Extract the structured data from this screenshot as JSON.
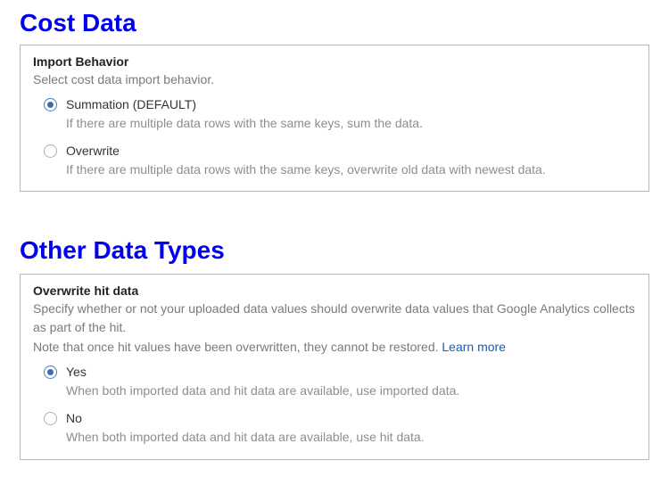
{
  "section1": {
    "heading": "Cost Data",
    "group_title": "Import Behavior",
    "group_desc": "Select cost data import behavior.",
    "options": [
      {
        "label": "Summation (DEFAULT)",
        "help": "If there are multiple data rows with the same keys, sum the data.",
        "selected": true
      },
      {
        "label": "Overwrite",
        "help": "If there are multiple data rows with the same keys, overwrite old data with newest data.",
        "selected": false
      }
    ]
  },
  "section2": {
    "heading": "Other Data Types",
    "group_title": "Overwrite hit data",
    "group_desc": "Specify whether or not your uploaded data values should overwrite data values that Google Analytics collects as part of the hit.",
    "group_note": "Note that once hit values have been overwritten, they cannot be restored. ",
    "learn_more": "Learn more",
    "options": [
      {
        "label": "Yes",
        "help": "When both imported data and hit data are available, use imported data.",
        "selected": true
      },
      {
        "label": "No",
        "help": "When both imported data and hit data are available, use hit data.",
        "selected": false
      }
    ]
  }
}
